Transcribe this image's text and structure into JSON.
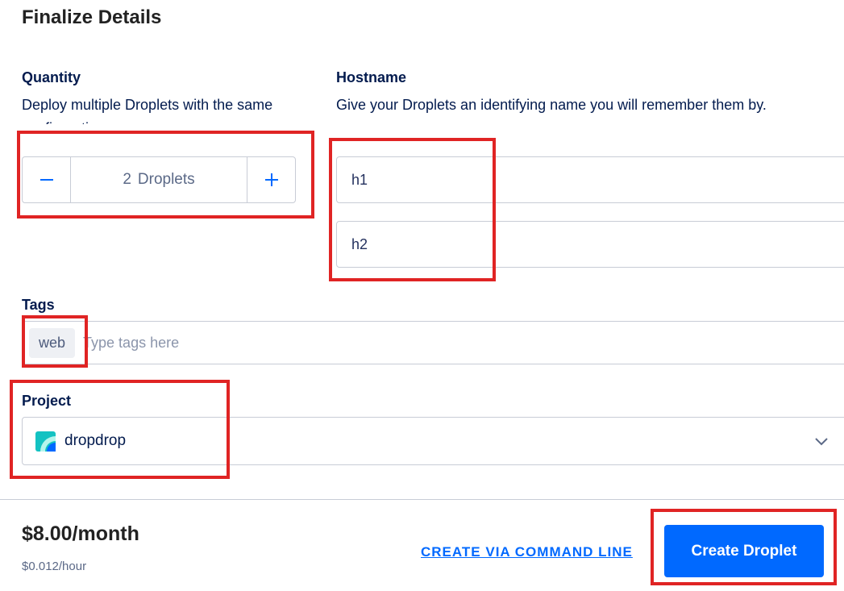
{
  "page": {
    "title": "Finalize Details"
  },
  "quantity": {
    "title": "Quantity",
    "description": "Deploy multiple Droplets with the same configuration",
    "minus_label": "−",
    "plus_label": "+",
    "count": "2",
    "unit": "Droplets"
  },
  "hostname": {
    "title": "Hostname",
    "description": "Give your Droplets an identifying name you will remember them by.",
    "values": [
      "h1",
      "h2"
    ]
  },
  "tags": {
    "title": "Tags",
    "chips": [
      "web"
    ],
    "placeholder": "Type tags here"
  },
  "project": {
    "title": "Project",
    "selected": "dropdrop"
  },
  "footer": {
    "price": "$8.00/month",
    "price_hour": "$0.012/hour",
    "cli_link": "CREATE VIA COMMAND LINE",
    "create_button": "Create Droplet"
  },
  "colors": {
    "accent": "#0069ff",
    "highlight": "#e02424",
    "text": "#031b4e"
  }
}
